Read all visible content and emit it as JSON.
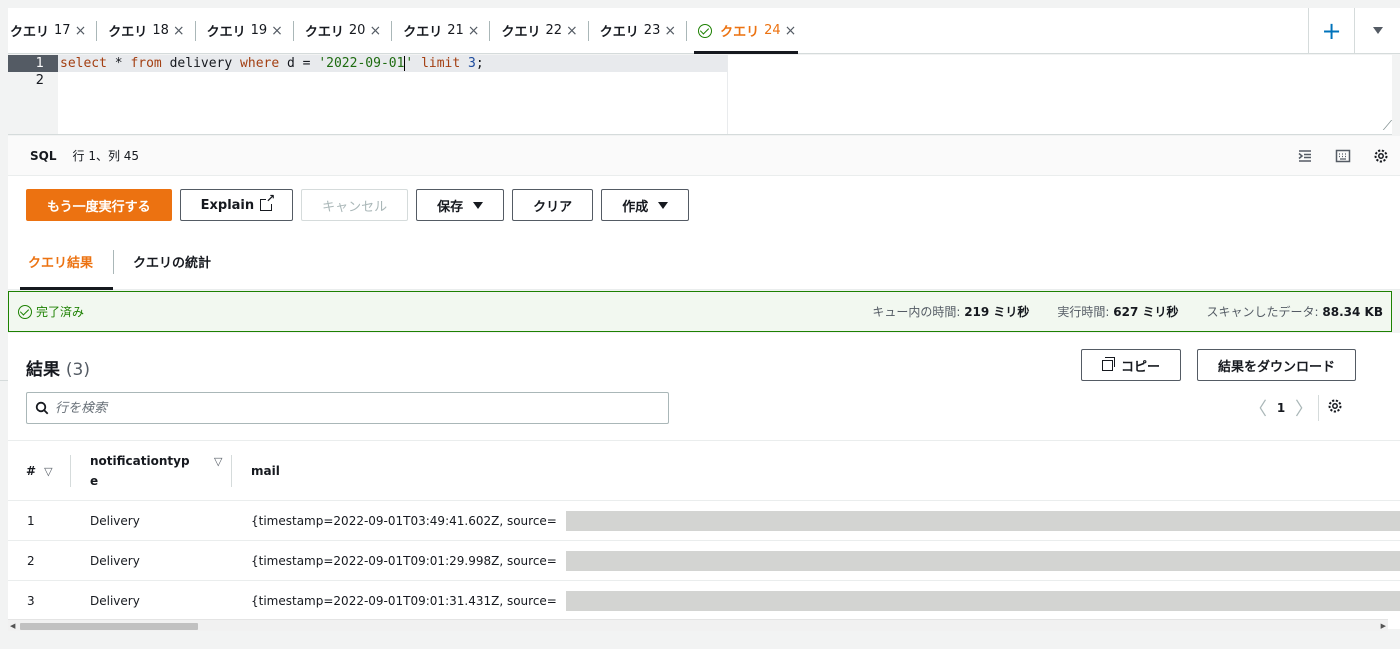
{
  "tabs": [
    {
      "label": "クエリ",
      "num": "17",
      "close": "×"
    },
    {
      "label": "クエリ",
      "num": "18",
      "close": "×"
    },
    {
      "label": "クエリ",
      "num": "19",
      "close": "×"
    },
    {
      "label": "クエリ",
      "num": "20",
      "close": "×"
    },
    {
      "label": "クエリ",
      "num": "21",
      "close": "×"
    },
    {
      "label": "クエリ",
      "num": "22",
      "close": "×"
    },
    {
      "label": "クエリ",
      "num": "23",
      "close": "×"
    },
    {
      "label": "クエリ",
      "num": "24",
      "close": "×",
      "active": true,
      "status_icon": "check-circle-icon"
    }
  ],
  "tab_actions": {
    "add": "+",
    "more_icon": "caret-down-icon"
  },
  "editor": {
    "line_numbers": [
      "1",
      "2"
    ],
    "line1": {
      "select": "select",
      "star": " * ",
      "from": "from",
      "table": " delivery ",
      "where": "where",
      "cond": " d = ",
      "date": "'2022-09-01",
      "date_close": "'",
      "limit": " limit ",
      "n": "3",
      "end": ";"
    }
  },
  "status_bar": {
    "language": "SQL",
    "position": "行 1、列 45",
    "icons": [
      "indent-icon",
      "keyboard-icon",
      "settings-icon"
    ]
  },
  "actions": {
    "run_again": "もう一度実行する",
    "explain": "Explain",
    "cancel": "キャンセル",
    "save": "保存",
    "clear": "クリア",
    "create": "作成"
  },
  "result_tabs": {
    "results": "クエリ結果",
    "stats": "クエリの統計"
  },
  "completion": {
    "status": "完了済み",
    "queue_label": "キュー内の時間:",
    "queue_value": "219 ミリ秒",
    "run_label": "実行時間:",
    "run_value": "627 ミリ秒",
    "scan_label": "スキャンしたデータ:",
    "scan_value": "88.34 KB"
  },
  "results": {
    "title": "結果",
    "count": "(3)",
    "copy": "コピー",
    "download": "結果をダウンロード",
    "search_placeholder": "行を検索",
    "page": "1",
    "columns": [
      {
        "label": "#"
      },
      {
        "label": "notificationtyp\ne"
      },
      {
        "label": "mail"
      }
    ],
    "rows": [
      {
        "index": "1",
        "type": "Delivery",
        "mail": "{timestamp=2022-09-01T03:49:41.602Z, source="
      },
      {
        "index": "2",
        "type": "Delivery",
        "mail": "{timestamp=2022-09-01T09:01:29.998Z, source="
      },
      {
        "index": "3",
        "type": "Delivery",
        "mail": "{timestamp=2022-09-01T09:01:31.431Z, source="
      }
    ]
  },
  "colors": {
    "accent": "#ec7211",
    "success": "#1d8102",
    "link": "#0073bb"
  }
}
